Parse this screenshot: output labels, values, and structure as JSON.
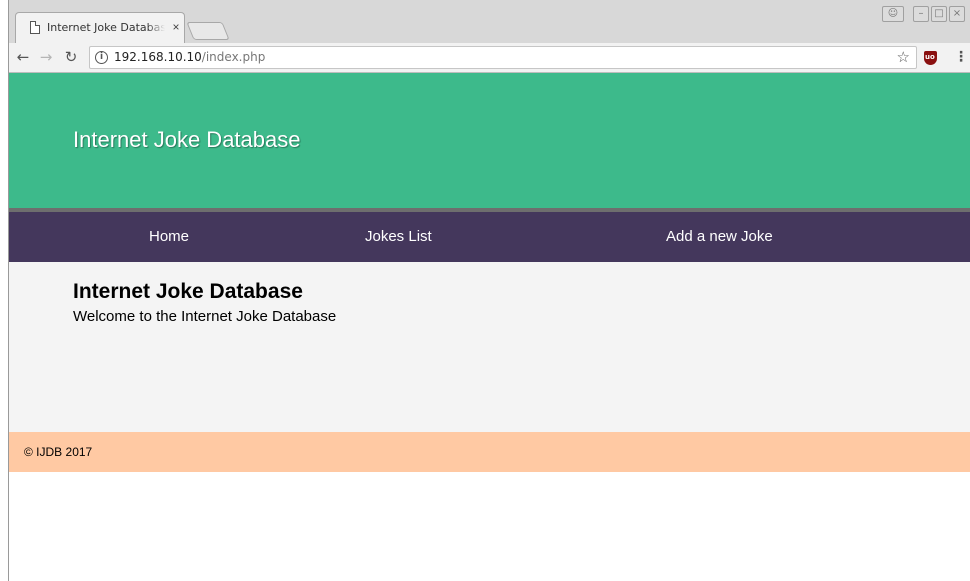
{
  "browser": {
    "tab_title": "Internet Joke Databas",
    "tab_close": "×",
    "url_host": "192.168.10.10",
    "url_path": "/index.php",
    "back_icon": "arrow-left-icon",
    "forward_icon": "arrow-right-icon",
    "reload_icon": "reload-icon",
    "info_icon": "info-icon",
    "bookmark_icon": "star-icon",
    "extension_icon": "ublock-icon",
    "menu_icon": "kebab-menu-icon"
  },
  "site": {
    "header_title": "Internet Joke Database",
    "nav": [
      {
        "label": "Home"
      },
      {
        "label": "Jokes List"
      },
      {
        "label": "Add a new Joke"
      }
    ],
    "main": {
      "heading": "Internet Joke Database",
      "text": "Welcome to the Internet Joke Database"
    },
    "footer": "© IJDB 2017"
  },
  "colors": {
    "header_bg": "#3dba8b",
    "nav_bg": "#44375c",
    "main_bg": "#f4f4f4",
    "footer_bg": "#ffc9a3"
  }
}
